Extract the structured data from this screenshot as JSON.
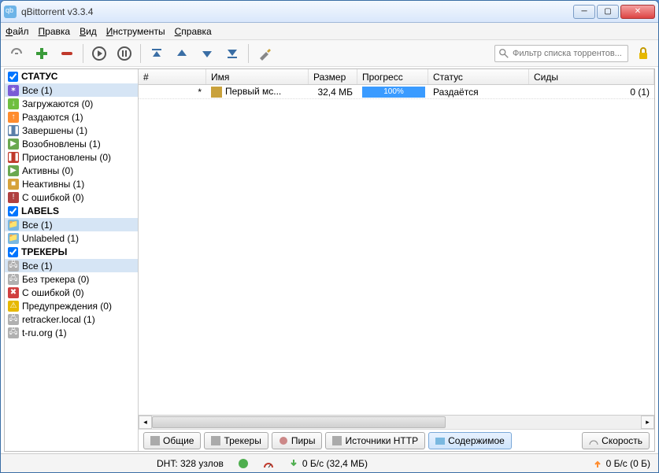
{
  "window": {
    "title": "qBittorrent v3.3.4"
  },
  "menu": {
    "file": "Файл",
    "edit": "Правка",
    "view": "Вид",
    "tools": "Инструменты",
    "help": "Справка"
  },
  "search": {
    "placeholder": "Фильтр списка торрентов..."
  },
  "sidebar": {
    "status": {
      "header": "СТАТУС",
      "items": [
        {
          "label": "Все (1)",
          "color": "#7a5cd6",
          "glyph": "✶",
          "selected": true
        },
        {
          "label": "Загружаются (0)",
          "color": "#6fbf3f",
          "glyph": "↓"
        },
        {
          "label": "Раздаются (1)",
          "color": "#ff8c2e",
          "glyph": "↑"
        },
        {
          "label": "Завершены (1)",
          "color": "#5a7fa8",
          "glyph": "❚❚"
        },
        {
          "label": "Возобновлены (1)",
          "color": "#6aa84f",
          "glyph": "▶"
        },
        {
          "label": "Приостановлены (0)",
          "color": "#c0392b",
          "glyph": "❚❚"
        },
        {
          "label": "Активны (0)",
          "color": "#6aa84f",
          "glyph": "▶"
        },
        {
          "label": "Неактивны (1)",
          "color": "#d6a23a",
          "glyph": "■"
        },
        {
          "label": "С ошибкой (0)",
          "color": "#b04040",
          "glyph": "!"
        }
      ]
    },
    "labels": {
      "header": "LABELS",
      "items": [
        {
          "label": "Все (1)",
          "color": "#7ab8e0",
          "glyph": "📁",
          "selected": true
        },
        {
          "label": "Unlabeled (1)",
          "color": "#7ab8e0",
          "glyph": "📁"
        }
      ]
    },
    "trackers": {
      "header": "ТРЕКЕРЫ",
      "items": [
        {
          "label": "Все (1)",
          "color": "#b0b0b0",
          "glyph": "🖧",
          "selected": true
        },
        {
          "label": "Без трекера (0)",
          "color": "#b0b0b0",
          "glyph": "🖧"
        },
        {
          "label": "С ошибкой (0)",
          "color": "#d04040",
          "glyph": "✖"
        },
        {
          "label": "Предупреждения (0)",
          "color": "#e6b800",
          "glyph": "⚠"
        },
        {
          "label": "retracker.local (1)",
          "color": "#b0b0b0",
          "glyph": "🖧"
        },
        {
          "label": "t-ru.org (1)",
          "color": "#b0b0b0",
          "glyph": "🖧"
        }
      ]
    }
  },
  "grid": {
    "headers": {
      "num": "#",
      "name": "Имя",
      "size": "Размер",
      "progress": "Прогресс",
      "status": "Статус",
      "seeds": "Сиды"
    },
    "rows": [
      {
        "num": "*",
        "name": "Первый мс...",
        "size": "32,4 МБ",
        "progress": "100%",
        "status": "Раздаётся",
        "seeds": "0 (1)"
      }
    ]
  },
  "tabs": {
    "general": "Общие",
    "trackers": "Трекеры",
    "peers": "Пиры",
    "http": "Источники HTTP",
    "content": "Содержимое",
    "speed": "Скорость"
  },
  "status": {
    "dht": "DHT: 328 узлов",
    "down": "0 Б/с (32,4 МБ)",
    "up": "0 Б/с (0 Б)"
  }
}
